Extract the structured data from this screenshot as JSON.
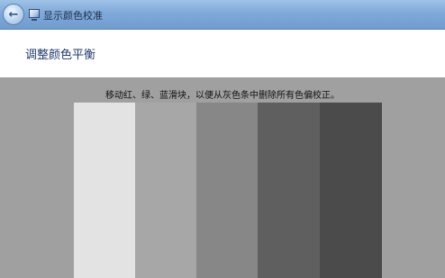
{
  "window": {
    "title": "显示颜色校准",
    "back_glyph": "←",
    "icon": "monitor-icon"
  },
  "header": {
    "heading": "调整颜色平衡"
  },
  "main": {
    "instruction": "移动红、绿、蓝滑块，以便从灰色条中删除所有色偏校正。",
    "bars": [
      {
        "color": "#e3e3e3"
      },
      {
        "color": "#a7a7a7"
      },
      {
        "color": "#878787"
      },
      {
        "color": "#5f5f5f"
      },
      {
        "color": "#4b4b4b"
      }
    ]
  },
  "colors": {
    "background": "#a0a0a0",
    "header_background": "#ffffff",
    "heading_text": "#1f3a6e"
  }
}
